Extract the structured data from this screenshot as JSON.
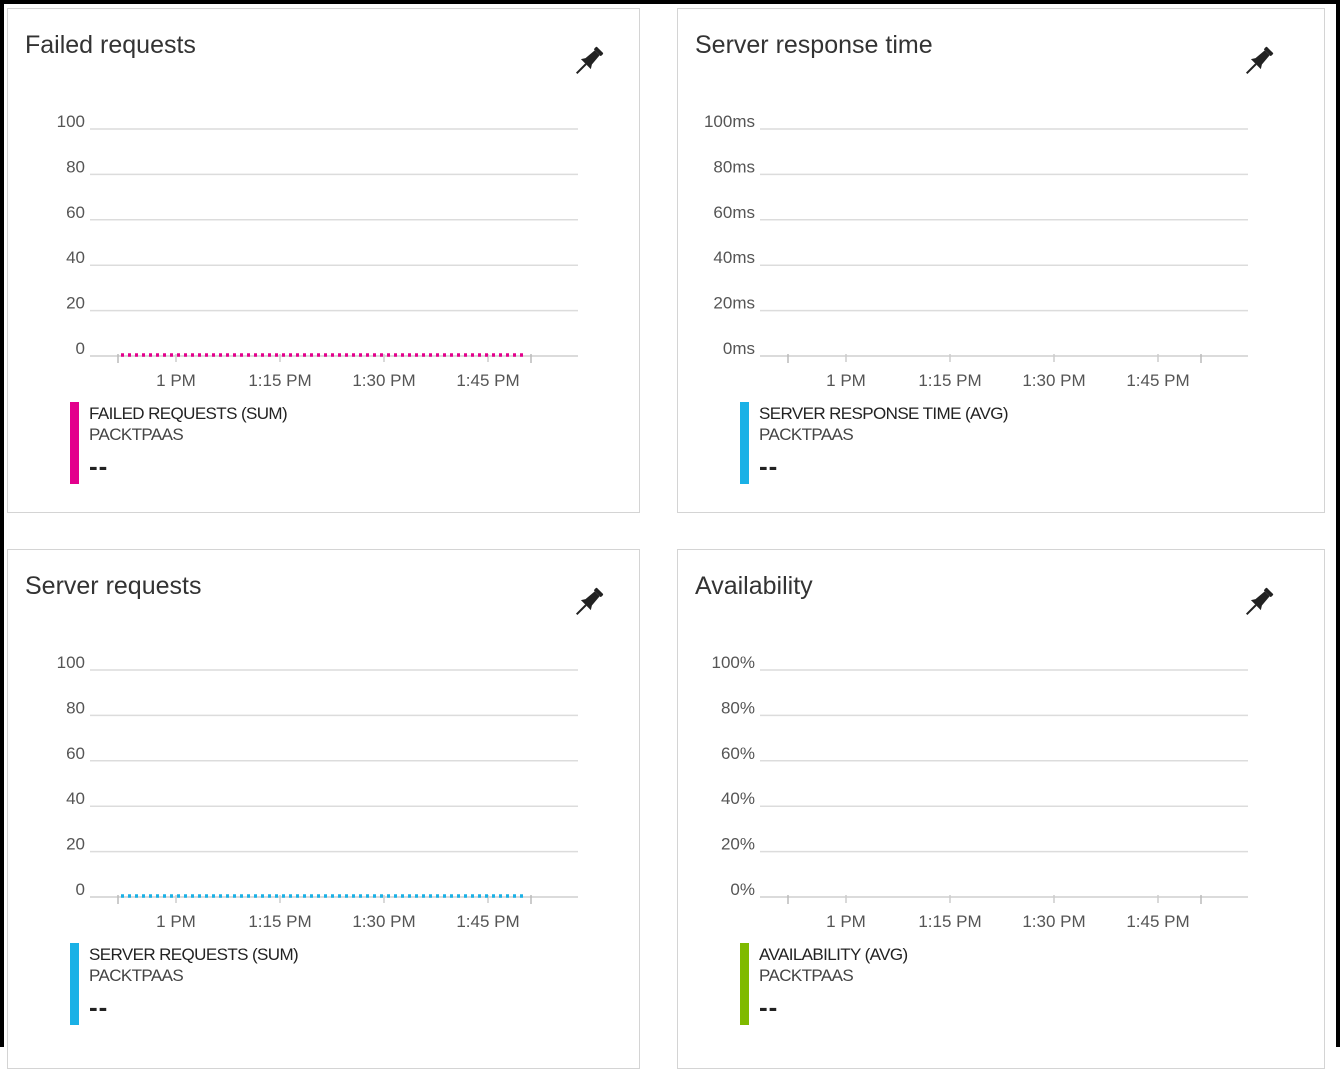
{
  "tiles": [
    {
      "title": "Failed requests",
      "y_ticks": [
        "100",
        "80",
        "60",
        "40",
        "20",
        "0"
      ],
      "x_ticks": [
        "1 PM",
        "1:15 PM",
        "1:30 PM",
        "1:45 PM"
      ],
      "legend_name": "FAILED REQUESTS (SUM)",
      "legend_source": "PACKTPAAS",
      "legend_value": "--",
      "series_color": "#e3008c",
      "show_series": true
    },
    {
      "title": "Server response time",
      "y_ticks": [
        "100ms",
        "80ms",
        "60ms",
        "40ms",
        "20ms",
        "0ms"
      ],
      "x_ticks": [
        "1 PM",
        "1:15 PM",
        "1:30 PM",
        "1:45 PM"
      ],
      "legend_name": "SERVER RESPONSE TIME (AVG)",
      "legend_source": "PACKTPAAS",
      "legend_value": "--",
      "series_color": "#1ab1e6",
      "show_series": false
    },
    {
      "title": "Server requests",
      "y_ticks": [
        "100",
        "80",
        "60",
        "40",
        "20",
        "0"
      ],
      "x_ticks": [
        "1 PM",
        "1:15 PM",
        "1:30 PM",
        "1:45 PM"
      ],
      "legend_name": "SERVER REQUESTS (SUM)",
      "legend_source": "PACKTPAAS",
      "legend_value": "--",
      "series_color": "#1ab1e6",
      "show_series": true
    },
    {
      "title": "Availability",
      "y_ticks": [
        "100%",
        "80%",
        "60%",
        "40%",
        "20%",
        "0%"
      ],
      "x_ticks": [
        "1 PM",
        "1:15 PM",
        "1:30 PM",
        "1:45 PM"
      ],
      "legend_name": "AVAILABILITY (AVG)",
      "legend_source": "PACKTPAAS",
      "legend_value": "--",
      "series_color": "#7fba00",
      "show_series": false
    }
  ],
  "pin_icon": "pin-icon"
}
